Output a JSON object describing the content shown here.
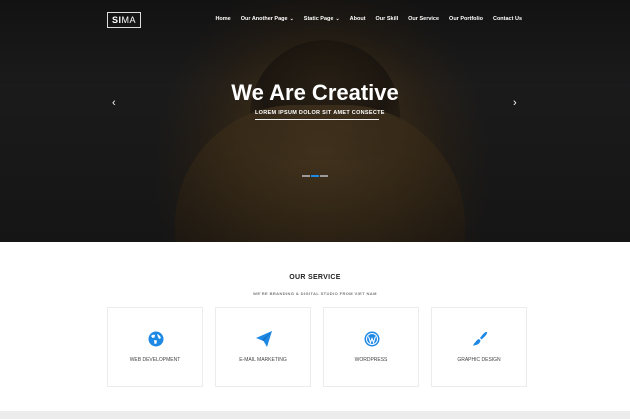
{
  "header": {
    "logo_bold": "SI",
    "logo_rest": "MA",
    "nav": [
      {
        "label": "Home",
        "dropdown": false
      },
      {
        "label": "Our Another Page",
        "dropdown": true
      },
      {
        "label": "Static Page",
        "dropdown": true
      },
      {
        "label": "About",
        "dropdown": false
      },
      {
        "label": "Our Skill",
        "dropdown": false
      },
      {
        "label": "Our Service",
        "dropdown": false
      },
      {
        "label": "Our Portfolio",
        "dropdown": false
      },
      {
        "label": "Contact Us",
        "dropdown": false
      }
    ]
  },
  "hero": {
    "title": "We Are Creative",
    "subtitle": "LOREM IPSUM DOLOR SIT AMET CONSECTE",
    "prev_icon": "chevron-left-icon",
    "next_icon": "chevron-right-icon",
    "slides": 3,
    "active_slide": 2
  },
  "services": {
    "title": "OUR SERVICE",
    "subtitle": "WE'RE BRANDING & DIGITAL STUDIO FROM VIET NAM",
    "accent": "#1e88e5",
    "items": [
      {
        "label": "WEB DEVELOPMENT",
        "icon": "globe-icon"
      },
      {
        "label": "E-MAIL MARKETING",
        "icon": "paper-plane-icon"
      },
      {
        "label": "WORDPRESS",
        "icon": "wordpress-icon"
      },
      {
        "label": "GRAPHIC DESIGN",
        "icon": "paint-brush-icon"
      }
    ]
  }
}
